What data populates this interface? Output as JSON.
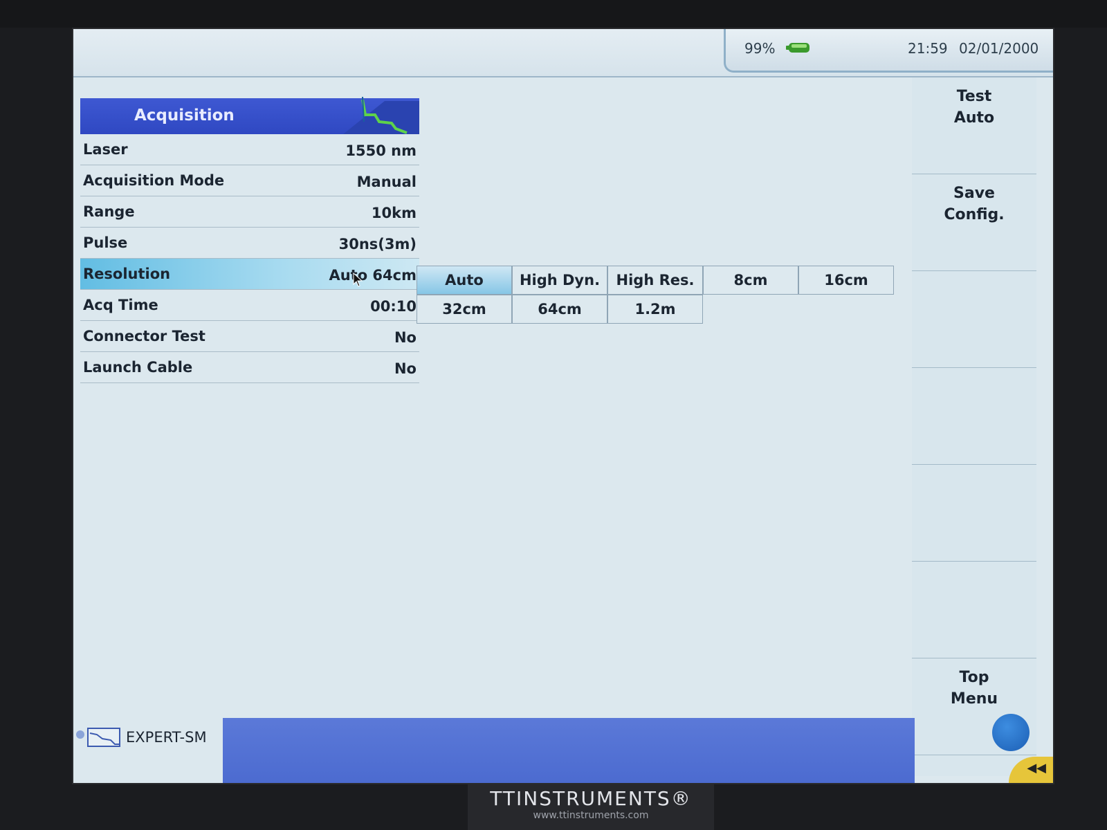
{
  "status": {
    "battery_percent": "99%",
    "battery_level": 0.99,
    "time": "21:59",
    "date": "02/01/2000"
  },
  "acquisition": {
    "title": "Acquisition",
    "rows": [
      {
        "label": "Laser",
        "value": "1550 nm"
      },
      {
        "label": "Acquisition Mode",
        "value": "Manual"
      },
      {
        "label": "Range",
        "value": "10km"
      },
      {
        "label": "Pulse",
        "value": "30ns(3m)"
      },
      {
        "label": "Resolution",
        "value": "Auto 64cm"
      },
      {
        "label": "Acq Time",
        "value": "00:10"
      },
      {
        "label": "Connector Test",
        "value": "No"
      },
      {
        "label": "Launch Cable",
        "value": "No"
      }
    ]
  },
  "resolution_options": [
    "Auto",
    "High Dyn.",
    "High Res.",
    "8cm",
    "16cm",
    "32cm",
    "64cm",
    "1.2m"
  ],
  "softkeys": {
    "test_auto": [
      "Test",
      "Auto"
    ],
    "save_config": [
      "Save",
      "Config."
    ],
    "top_menu": [
      "Top",
      "Menu"
    ]
  },
  "mode": {
    "label": "EXPERT-SM"
  },
  "brand": {
    "name": "TTINSTRUMENTS®",
    "url": "www.ttinstruments.com"
  }
}
